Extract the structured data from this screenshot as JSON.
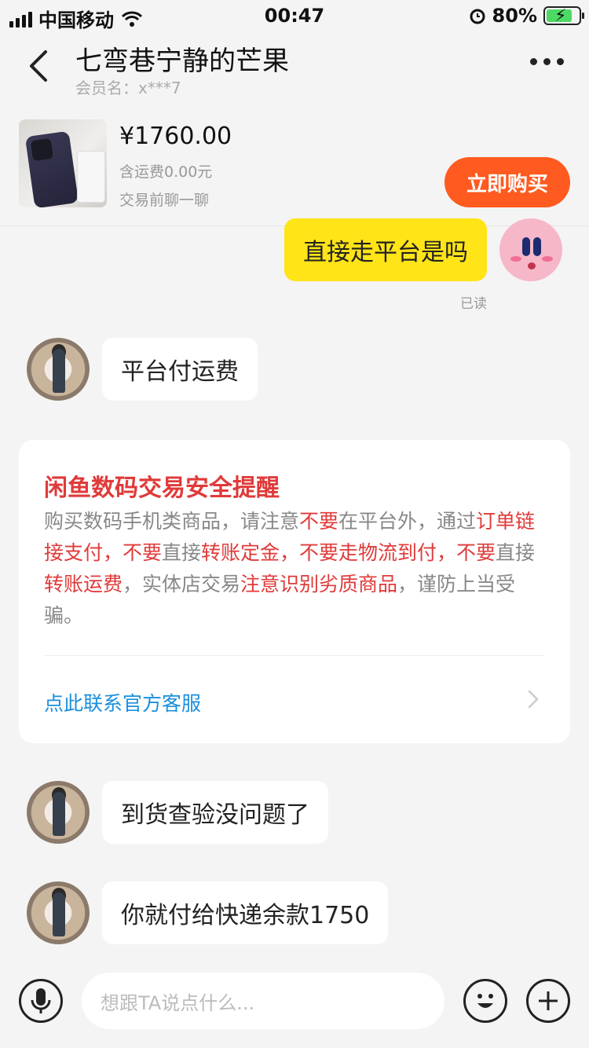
{
  "status_bar": {
    "carrier": "中国移动",
    "time": "00:47",
    "battery": "80%",
    "icons": [
      "signal-icon",
      "wifi-icon",
      "alarm-icon",
      "battery-icon"
    ]
  },
  "header": {
    "title": "七弯巷宁静的芒果",
    "subtitle": "会员名：x***7"
  },
  "product": {
    "price": "¥1760.00",
    "shipping": "含运费0.00元",
    "hint": "交易前聊一聊",
    "buy_label": "立即购买"
  },
  "messages": [
    {
      "side": "out",
      "text": "直接走平台是吗",
      "status": "已读"
    },
    {
      "side": "in",
      "text": "平台付运费"
    },
    {
      "side": "in",
      "text": "到货查验没问题了"
    },
    {
      "side": "in",
      "text": "你就付给快递余款1750"
    }
  ],
  "safety": {
    "title": "闲鱼数码交易安全提醒",
    "segments": [
      {
        "text": "购买数码手机类商品，请注意",
        "red": false
      },
      {
        "text": "不要",
        "red": true
      },
      {
        "text": "在平台外，通过",
        "red": false
      },
      {
        "text": "订单链接支付，不要",
        "red": true
      },
      {
        "text": "直接",
        "red": false
      },
      {
        "text": "转账定金，不要走物流到付，不要",
        "red": true
      },
      {
        "text": "直接",
        "red": false
      },
      {
        "text": "转账运费",
        "red": true
      },
      {
        "text": "，实体店交易",
        "red": false
      },
      {
        "text": "注意识别劣质商品",
        "red": true
      },
      {
        "text": "，谨防上当受骗。",
        "red": false
      }
    ],
    "contact_label": "点此联系官方客服"
  },
  "input": {
    "placeholder": "想跟TA说点什么..."
  },
  "colors": {
    "accent_yellow": "#ffe417",
    "buy_orange": "#ff5a1f",
    "warning_red": "#e03a3a",
    "link_blue": "#1a8fdd"
  }
}
